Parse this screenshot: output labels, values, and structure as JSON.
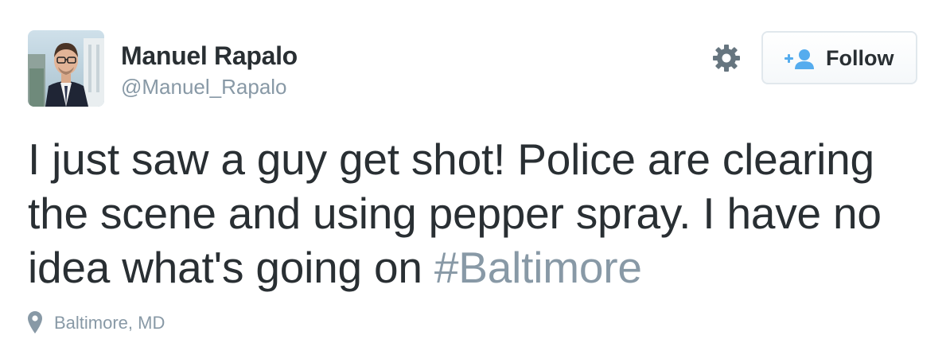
{
  "user": {
    "name": "Manuel Rapalo",
    "handle": "@Manuel_Rapalo"
  },
  "actions": {
    "settings_icon": "gear-icon",
    "follow_icon": "follow-person-plus-icon",
    "follow_label": "Follow"
  },
  "tweet": {
    "text": "I just saw a guy get shot! Police are clearing the scene and using pepper spray. I have no idea what's going on ",
    "hashtag": "#Baltimore"
  },
  "location": {
    "icon": "map-pin-icon",
    "label": "Baltimore, MD"
  },
  "colors": {
    "text": "#292f33",
    "muted": "#8899a6",
    "follow_icon": "#55acee",
    "border": "#e1e8ed"
  }
}
